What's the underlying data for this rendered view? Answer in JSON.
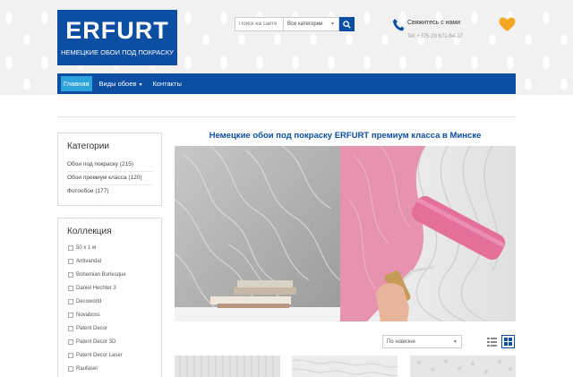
{
  "logo": {
    "name": "ERFURT",
    "tagline": "НЕМЕЦКИЕ ОБОИ ПОД ПОКРАСКУ"
  },
  "search": {
    "placeholder": "Поиск на сайте",
    "category": "Все категории"
  },
  "contact": {
    "title": "Свяжитесь с нами",
    "phone": "Tel: +375 29 671-64-17"
  },
  "nav": {
    "items": [
      {
        "label": "Главная"
      },
      {
        "label": "Виды обоев"
      },
      {
        "label": "Контакты"
      }
    ]
  },
  "categories": {
    "title": "Категории",
    "items": [
      {
        "label": "Обои под покраску (215)"
      },
      {
        "label": "Обои премиум класса (120)"
      },
      {
        "label": "Фотообои (177)"
      }
    ]
  },
  "collection": {
    "title": "Коллекция",
    "items": [
      {
        "label": "50 x 1 м"
      },
      {
        "label": "Antivandal"
      },
      {
        "label": "Bohemian Burlesque"
      },
      {
        "label": "Daniel Hechter 3"
      },
      {
        "label": "Decoworld"
      },
      {
        "label": "Novaboss"
      },
      {
        "label": "Patent Decor"
      },
      {
        "label": "Patent Decor 3D"
      },
      {
        "label": "Patent Decor Laser"
      },
      {
        "label": "Raufaser"
      }
    ]
  },
  "main": {
    "title": "Немецкие обои под покраску ERFURT премиум класса в Минске"
  },
  "sort": {
    "selected": "По новизне"
  },
  "colors": {
    "brand": "#0b4ea2",
    "accent": "#2fa4dc",
    "heart": "#f5a623",
    "pink": "#e68aa8"
  }
}
